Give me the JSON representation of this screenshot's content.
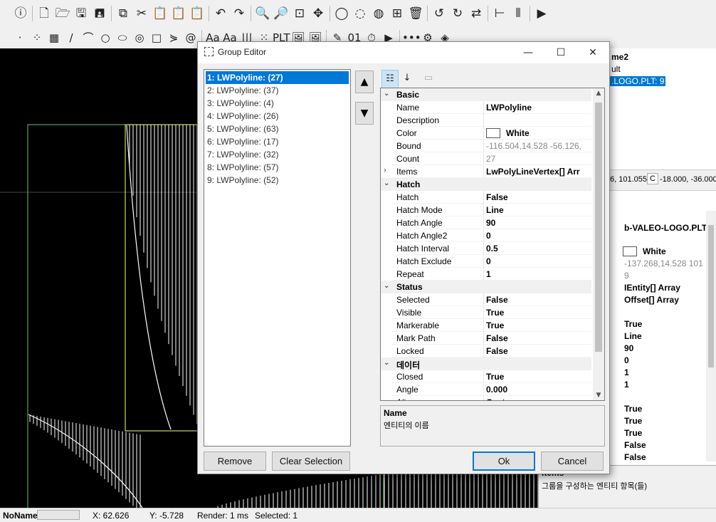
{
  "toolbar": {
    "row1": [
      "info-icon",
      "new-file-icon",
      "open-folder-icon",
      "save-icon",
      "save-as-icon",
      "copy-icon",
      "cut-icon",
      "paste-icon",
      "paste-special-icon",
      "paste-clip-icon",
      "undo-icon",
      "redo-icon",
      "zoom-out-icon",
      "zoom-in-icon",
      "zoom-window-icon",
      "pan-icon",
      "circle-select-icon",
      "lasso-icon",
      "hatch-icon",
      "group-icon",
      "delete-icon",
      "rotate-ccw-icon",
      "rotate-cw-icon",
      "swap-icon",
      "align-left-icon",
      "columns-icon",
      "run-icon"
    ],
    "row1_glyphs": [
      "ⓘ",
      "🗋",
      "🗁",
      "🖫",
      "🖪",
      "⧉",
      "✂",
      "📋",
      "📋",
      "📋",
      "↶",
      "↷",
      "🔍",
      "🔎",
      "⊡",
      "✥",
      "◯",
      "◌",
      "◍",
      "⊞",
      "🗑",
      "↺",
      "↻",
      "⇄",
      "⊢",
      "⦀",
      "▶"
    ],
    "row2": [
      "point-icon",
      "dots-icon",
      "grid-icon",
      "line-icon",
      "arc-icon",
      "circle-icon",
      "ellipse-icon",
      "target-icon",
      "rect-icon",
      "polyline-icon",
      "spiral-icon",
      "text-icon",
      "bold-text-icon",
      "barcode-icon",
      "qrcode-icon",
      "plt-icon",
      "image-icon",
      "image-edit-icon",
      "pen-icon",
      "binary-icon",
      "timer-icon",
      "play-icon",
      "more-icon",
      "gear-icon",
      "layers-icon"
    ],
    "row2_glyphs": [
      "·",
      "⁘",
      "▦",
      "/",
      "⌒",
      "○",
      "⬭",
      "◎",
      "□",
      "⋟",
      "@",
      "Aa",
      "Aa",
      "|||",
      "⁙",
      "PLT",
      "🖼",
      "🖼",
      "✎",
      "01",
      "⏱",
      "▶",
      "•••",
      "⚙",
      "◈"
    ]
  },
  "right_panel": {
    "name_header": "me2",
    "default_label": "ult",
    "selected_file": ".LOGO.PLT: 9",
    "coord_a": "6, 101.055",
    "coord_c_label": "C",
    "coord_c": "-18.000, -36.000",
    "file_name": "b-VALEO-LOGO.PLT",
    "color": "White",
    "bound": "-137.268,14.528 101",
    "count": "9",
    "entity_array": "IEntity[] Array",
    "offset_array": "Offset[] Array",
    "hatch_values": [
      "True",
      "Line",
      "90",
      "0",
      "1",
      "1"
    ],
    "status_values": [
      "True",
      "True",
      "True",
      "False",
      "False"
    ],
    "desc_title": "Items",
    "desc_text": "그룹을 구성하는 엔티티 항목(들)"
  },
  "status_bar": {
    "name": "NoName",
    "x": "X: 62.626",
    "y": "Y: -5.728",
    "render": "Render: 1 ms",
    "selected": "Selected: 1"
  },
  "dialog": {
    "title": "Group Editor",
    "minimize": "—",
    "maximize": "☐",
    "close": "✕",
    "items": [
      "1: LWPolyline: (27)",
      "2: LWPolyline: (37)",
      "3: LWPolyline: (4)",
      "4: LWPolyline: (26)",
      "5: LWPolyline: (63)",
      "6: LWPolyline: (17)",
      "7: LWPolyline: (32)",
      "8: LWPolyline: (57)",
      "9: LWPolyline: (52)"
    ],
    "move_up": "▲",
    "move_down": "▼",
    "remove_label": "Remove",
    "clear_selection_label": "Clear Selection",
    "ok_label": "Ok",
    "cancel_label": "Cancel",
    "grid": {
      "basic": "Basic",
      "name_l": "Name",
      "name_v": "LWPolyline",
      "description_l": "Description",
      "description_v": "",
      "color_l": "Color",
      "color_v": "White",
      "bound_l": "Bound",
      "bound_v": "-116.504,14.528 -56.126,",
      "count_l": "Count",
      "count_v": "27",
      "items_l": "Items",
      "items_v": "LwPolyLineVertex[] Arr",
      "hatch": "Hatch",
      "hatch_l": "Hatch",
      "hatch_v": "False",
      "hatch_mode_l": "Hatch Mode",
      "hatch_mode_v": "Line",
      "hatch_angle_l": "Hatch Angle",
      "hatch_angle_v": "90",
      "hatch_angle2_l": "Hatch Angle2",
      "hatch_angle2_v": "0",
      "hatch_interval_l": "Hatch Interval",
      "hatch_interval_v": "0.5",
      "hatch_exclude_l": "Hatch Exclude",
      "hatch_exclude_v": "0",
      "repeat_l": "Repeat",
      "repeat_v": "1",
      "status": "Status",
      "selected_l": "Selected",
      "selected_v": "False",
      "visible_l": "Visible",
      "visible_v": "True",
      "markerable_l": "Markerable",
      "markerable_v": "True",
      "mark_path_l": "Mark Path",
      "mark_path_v": "False",
      "locked_l": "Locked",
      "locked_v": "False",
      "data": "데이터",
      "closed_l": "Closed",
      "closed_v": "True",
      "angle_l": "Angle",
      "angle_v": "0.000",
      "align_l": "Align",
      "align_v": "Center"
    },
    "desc_title": "Name",
    "desc_text": "엔티티의 이름"
  }
}
